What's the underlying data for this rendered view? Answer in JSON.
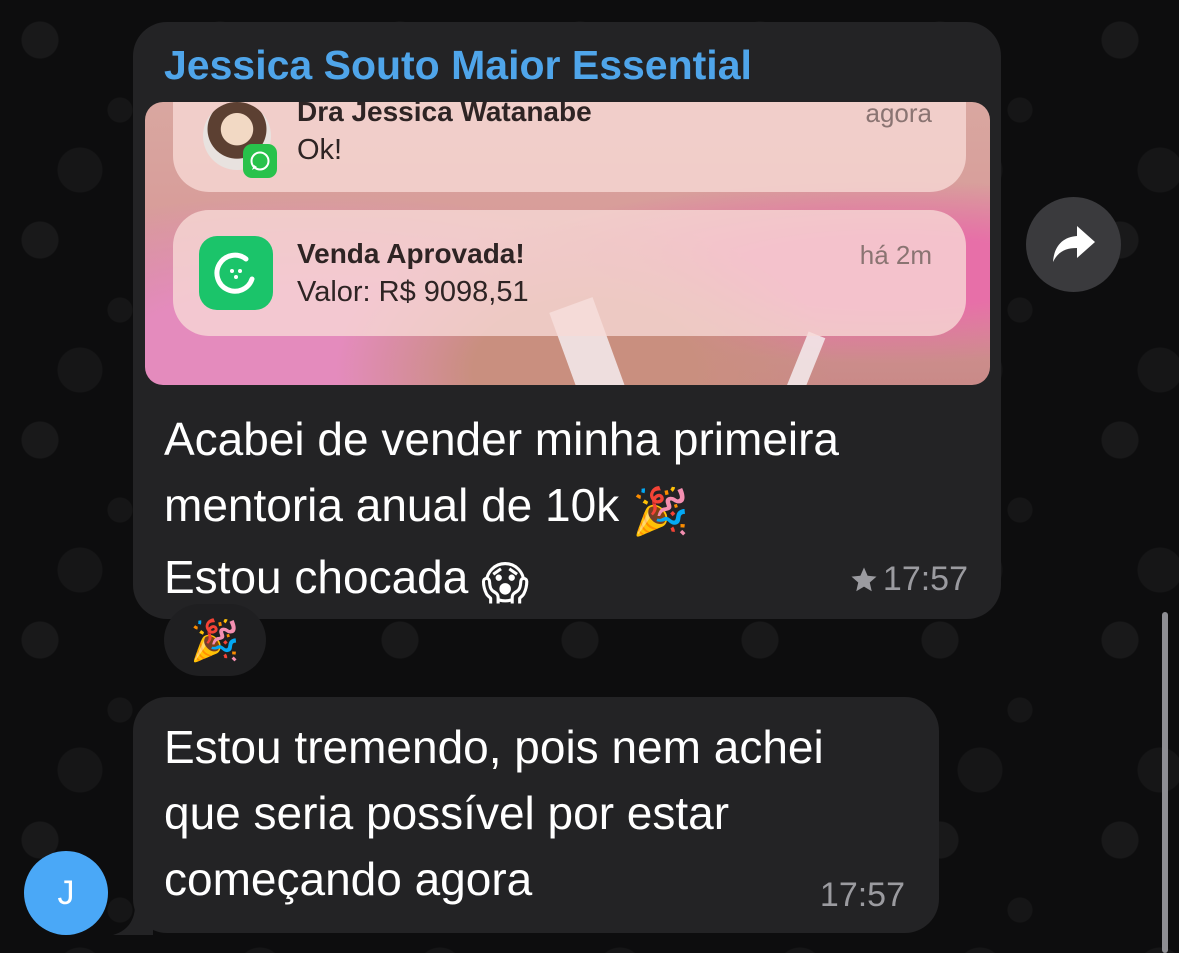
{
  "chat": {
    "sender_name": "Jessica Souto Maior Essential",
    "message1": {
      "notifications": [
        {
          "title": "Dra Jessica Watanabe",
          "body": "Ok!",
          "time": "agora",
          "app_icon": "whatsapp-icon"
        },
        {
          "title": "Venda Aprovada!",
          "body": "Valor: R$ 9098,51",
          "time": "há 2m",
          "app_icon": "kiwify-icon"
        }
      ],
      "text_line1": "Acabei de vender minha primeira",
      "text_line2": "mentoria anual de 10k",
      "text_line3": "Estou chocada",
      "emoji_party": "🎉",
      "emoji_shock": "😱",
      "time": "17:57",
      "starred_icon": "star-icon"
    },
    "reaction": {
      "emoji": "🎉"
    },
    "message2": {
      "text_line1": "Estou tremendo, pois nem achei",
      "text_line2": "que seria possível por estar",
      "text_line3": "começando agora",
      "time": "17:57"
    },
    "user_avatar_initial": "J"
  },
  "colors": {
    "sender_name": "#4fa5ea",
    "bubble": "#232325",
    "avatar": "#4aa8f7",
    "background": "#0d0d0e"
  }
}
